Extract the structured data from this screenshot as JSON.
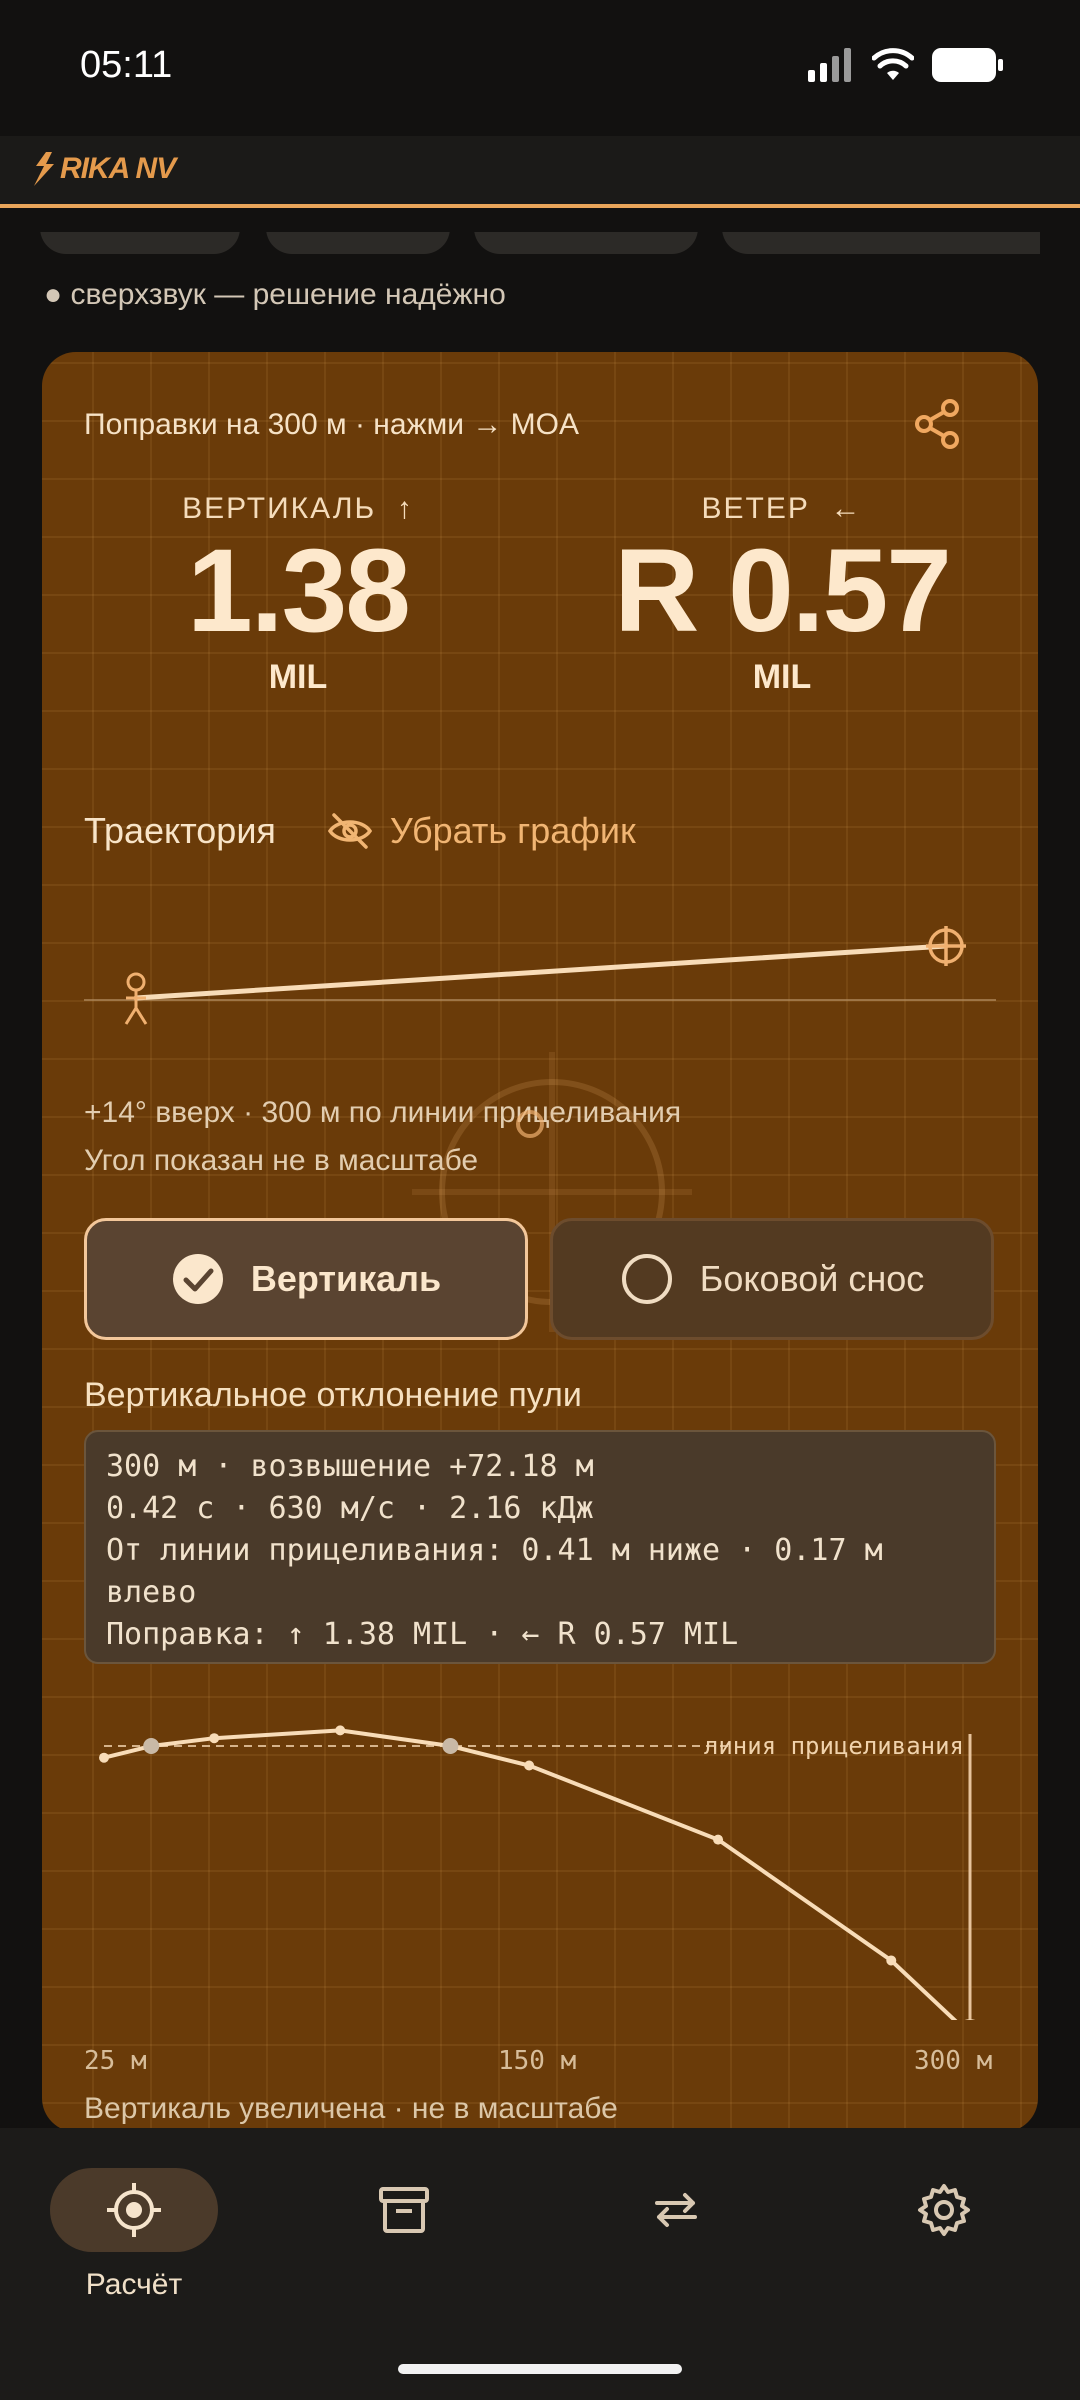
{
  "status_bar": {
    "time": "05:11"
  },
  "app": {
    "logo_text": "RIKA NV"
  },
  "status_line": "● сверхзвук — решение надёжно",
  "card": {
    "title": "Поправки на 300 м · нажми → MOA",
    "vertical": {
      "label": "ВЕРТИКАЛЬ",
      "arrow": "↑",
      "value": "1.38",
      "unit": "MIL"
    },
    "wind": {
      "label": "ВЕТЕР",
      "arrow": "←",
      "value": "R 0.57",
      "unit": "MIL"
    },
    "trajectory": {
      "title": "Траектория",
      "hide_label": "Убрать график",
      "angle_deg": 14,
      "note1": "+14° вверх · 300 м по линии прицеливания",
      "note2": "Угол показан не в масштабе"
    },
    "toggles": {
      "selected": "Вертикаль",
      "other": "Боковой снос"
    },
    "deviation": {
      "title": "Вертикальное отклонение пули",
      "lines": [
        "300 м · возвышение +72.18 м",
        "0.42 с · 630 м/с · 2.16 кДж",
        "От линии прицеливания: 0.41 м ниже · 0.17 м",
        "влево",
        "Поправка: ↑ 1.38 MIL · ← R 0.57 MIL"
      ],
      "sight_line_label": "линия прицеливания",
      "axis": {
        "start": "25 м",
        "mid": "150 м",
        "end": "300 м"
      },
      "footnote": "Вертикаль увеличена · не в масштабе"
    }
  },
  "chart_data": {
    "type": "line",
    "x": [
      25,
      40,
      60,
      100,
      135,
      160,
      220,
      275,
      300
    ],
    "series": [
      {
        "values": [
          -0.03,
          0.0,
          0.02,
          0.04,
          0.0,
          -0.05,
          -0.24,
          -0.55,
          -0.74
        ]
      }
    ],
    "markers_at": [
      40,
      135,
      300
    ],
    "xlim": [
      25,
      300
    ],
    "xticks": [
      "25 м",
      "150 м",
      "300 м"
    ],
    "annotations": [
      "линия прицеливания"
    ]
  },
  "nav": {
    "items": [
      {
        "label": "Расчёт",
        "icon": "crosshair-icon",
        "active": true
      },
      {
        "label": "",
        "icon": "archive-icon",
        "active": false
      },
      {
        "label": "",
        "icon": "swap-icon",
        "active": false
      },
      {
        "label": "",
        "icon": "gear-icon",
        "active": false
      }
    ]
  },
  "colors": {
    "accent": "#e9a55a",
    "card_bg": "#6a3b09",
    "text_light": "#fde8cc"
  }
}
